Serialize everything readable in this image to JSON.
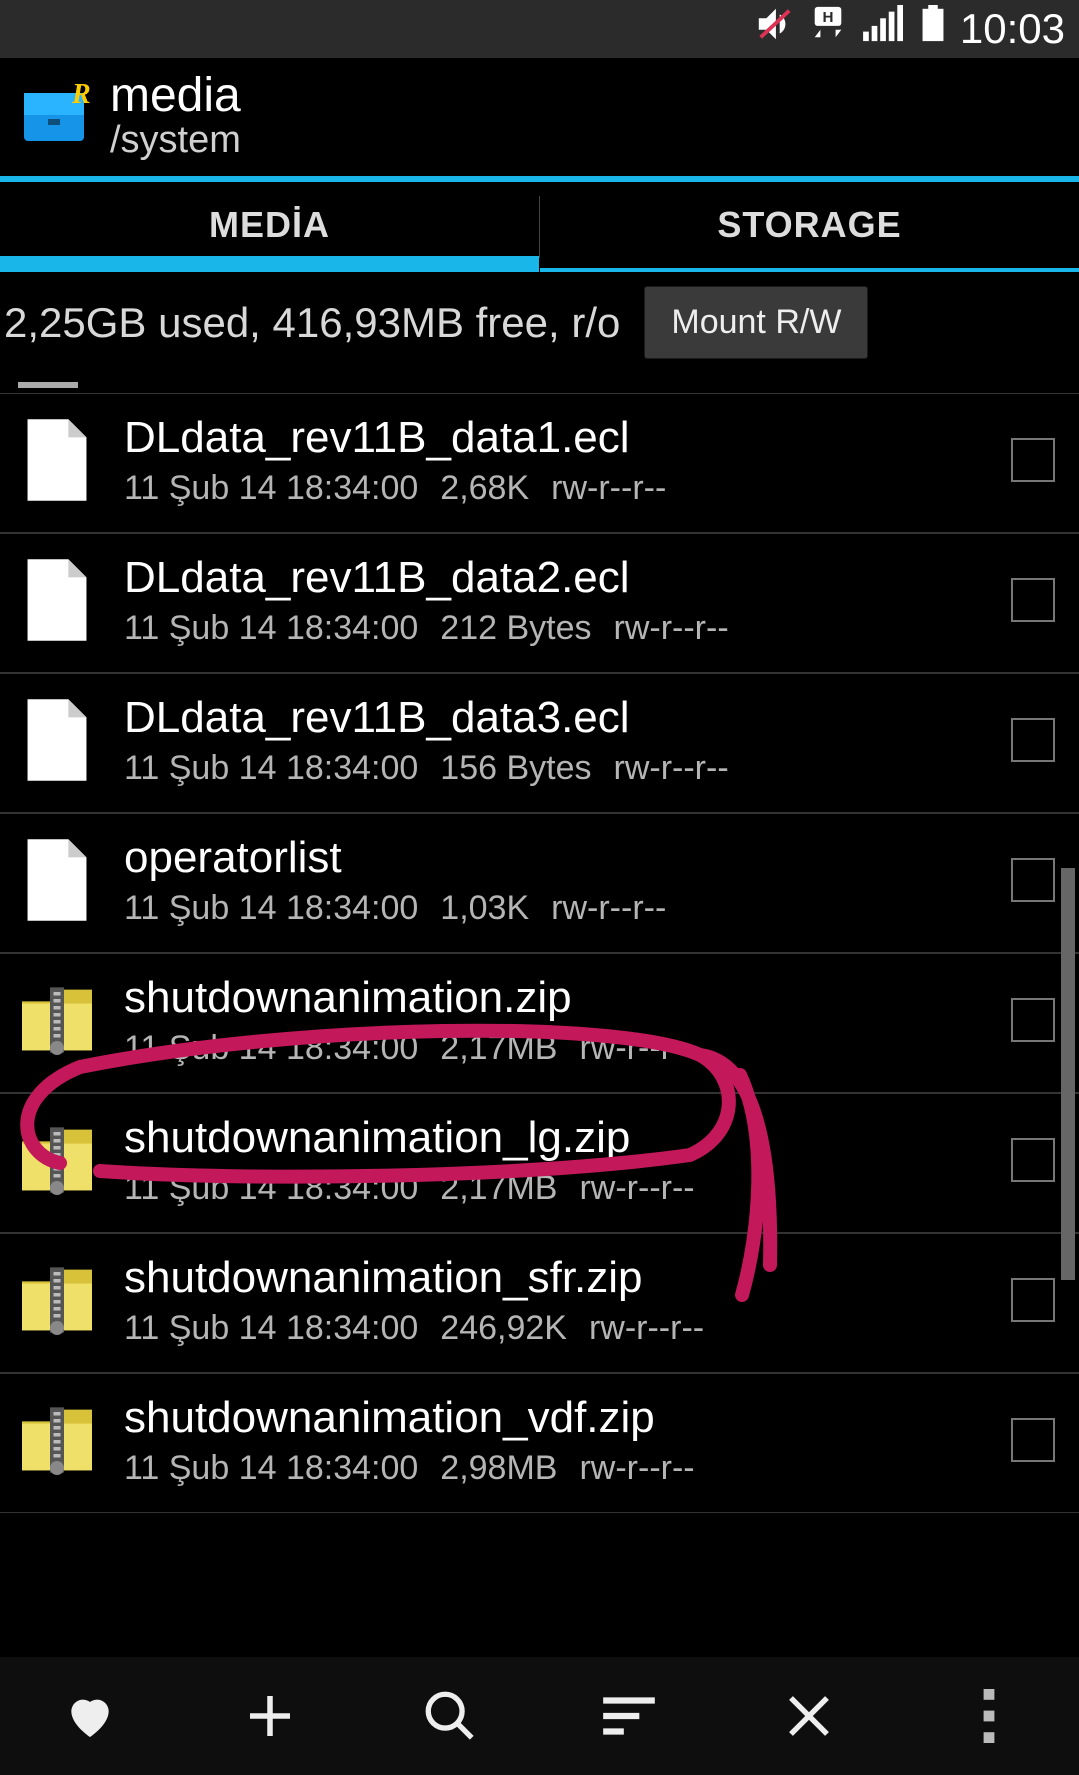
{
  "statusbar": {
    "time": "10:03"
  },
  "header": {
    "title": "media",
    "path": "/system"
  },
  "tabs": [
    {
      "label": "MEDİA",
      "active": true
    },
    {
      "label": "STORAGE",
      "active": false
    }
  ],
  "storage": {
    "summary": "2,25GB used, 416,93MB free, r/o"
  },
  "buttons": {
    "mount": "Mount R/W"
  },
  "files": [
    {
      "icon": "file",
      "name": "DLdata_rev11B_data1.ecl",
      "date": "11 Şub 14 18:34:00",
      "size": "2,68K",
      "perm": "rw-r--r--"
    },
    {
      "icon": "file",
      "name": "DLdata_rev11B_data2.ecl",
      "date": "11 Şub 14 18:34:00",
      "size": "212 Bytes",
      "perm": "rw-r--r--"
    },
    {
      "icon": "file",
      "name": "DLdata_rev11B_data3.ecl",
      "date": "11 Şub 14 18:34:00",
      "size": "156 Bytes",
      "perm": "rw-r--r--"
    },
    {
      "icon": "file",
      "name": "operatorlist",
      "date": "11 Şub 14 18:34:00",
      "size": "1,03K",
      "perm": "rw-r--r--"
    },
    {
      "icon": "zip",
      "name": "shutdownanimation.zip",
      "date": "11 Şub 14 18:34:00",
      "size": "2,17MB",
      "perm": "rw-r--r--"
    },
    {
      "icon": "zip",
      "name": "shutdownanimation_lg.zip",
      "date": "11 Şub 14 18:34:00",
      "size": "2,17MB",
      "perm": "rw-r--r--"
    },
    {
      "icon": "zip",
      "name": "shutdownanimation_sfr.zip",
      "date": "11 Şub 14 18:34:00",
      "size": "246,92K",
      "perm": "rw-r--r--"
    },
    {
      "icon": "zip",
      "name": "shutdownanimation_vdf.zip",
      "date": "11 Şub 14 18:34:00",
      "size": "2,98MB",
      "perm": "rw-r--r--"
    }
  ]
}
